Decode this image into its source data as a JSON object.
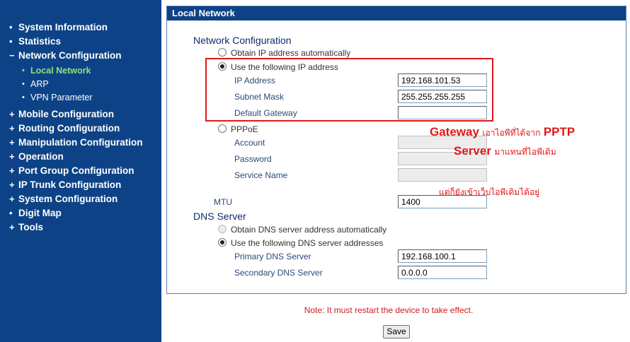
{
  "sidebar": {
    "items": [
      {
        "mark": "•",
        "label": "System Information"
      },
      {
        "mark": "•",
        "label": "Statistics"
      },
      {
        "mark": "−",
        "label": "Network Configuration"
      },
      {
        "mark": "+",
        "label": "Mobile Configuration"
      },
      {
        "mark": "+",
        "label": "Routing Configuration"
      },
      {
        "mark": "+",
        "label": "Manipulation Configuration"
      },
      {
        "mark": "+",
        "label": "Operation"
      },
      {
        "mark": "+",
        "label": "Port Group Configuration"
      },
      {
        "mark": "+",
        "label": "IP Trunk Configuration"
      },
      {
        "mark": "+",
        "label": "System Configuration"
      },
      {
        "mark": "•",
        "label": "Digit Map"
      },
      {
        "mark": "+",
        "label": "Tools"
      }
    ],
    "subitems": [
      {
        "mark": "•",
        "label": "Local Network",
        "active": true
      },
      {
        "mark": "•",
        "label": "ARP"
      },
      {
        "mark": "•",
        "label": "VPN Parameter"
      }
    ]
  },
  "panel": {
    "title": "Local Network",
    "network_section": "Network Configuration",
    "obtain_auto": "Obtain IP address automatically",
    "use_following": "Use the following IP address",
    "ip_address_label": "IP Address",
    "ip_address_value": "192.168.101.53",
    "subnet_mask_label": "Subnet Mask",
    "subnet_mask_value": "255.255.255.255",
    "default_gateway_label": "Default Gateway",
    "default_gateway_value": "",
    "pppoe": "PPPoE",
    "account_label": "Account",
    "password_label": "Password",
    "service_name_label": "Service Name",
    "mtu_label": "MTU",
    "mtu_value": "1400",
    "dns_section": "DNS Server",
    "dns_obtain_auto": "Obtain DNS server address automatically",
    "dns_use_following": "Use the following DNS server addresses",
    "primary_dns_label": "Primary DNS Server",
    "primary_dns_value": "192.168.100.1",
    "secondary_dns_label": "Secondary DNS Server",
    "secondary_dns_value": "0.0.0.0"
  },
  "annotation": {
    "word_gateway": "Gateway",
    "line1_thai": "เอาไอพีที่ได้จาก",
    "word_pptp": "PPTP",
    "word_server": "Server",
    "line2_thai": "มาแทนที่ไอพีเดิม",
    "line3_thai": "แต่ก็ยังเข้าเว็บไอพีเดิมได้อยู่"
  },
  "note": "Note: It must restart the device to take effect.",
  "save_label": "Save",
  "colors": {
    "sidebar_bg": "#0d4386",
    "active_item": "#8fe07a",
    "annotation_red": "#e01818"
  }
}
